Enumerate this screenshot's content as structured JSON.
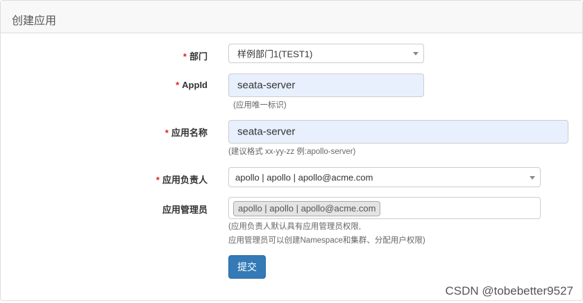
{
  "panel": {
    "title": "创建应用"
  },
  "form": {
    "department": {
      "label": "部门",
      "value": "样例部门1(TEST1)"
    },
    "appid": {
      "label": "AppId",
      "value": "seata-server",
      "help": "(应用唯一标识)"
    },
    "app_name": {
      "label": "应用名称",
      "value": "seata-server",
      "help": "(建议格式 xx-yy-zz 例:apollo-server)"
    },
    "owner": {
      "label": "应用负责人",
      "value": "apollo | apollo | apollo@acme.com"
    },
    "admins": {
      "label": "应用管理员",
      "tags": [
        "apollo | apollo | apollo@acme.com"
      ],
      "help_line1": "(应用负责人默认具有应用管理员权限,",
      "help_line2": "应用管理员可以创建Namespace和集群、分配用户权限)"
    },
    "required_mark": "*",
    "submit_label": "提交"
  },
  "watermark": "CSDN @tobebetter9527",
  "colors": {
    "primary": "#337ab7",
    "required": "#e0211d",
    "autofill": "#e8f0fe"
  }
}
